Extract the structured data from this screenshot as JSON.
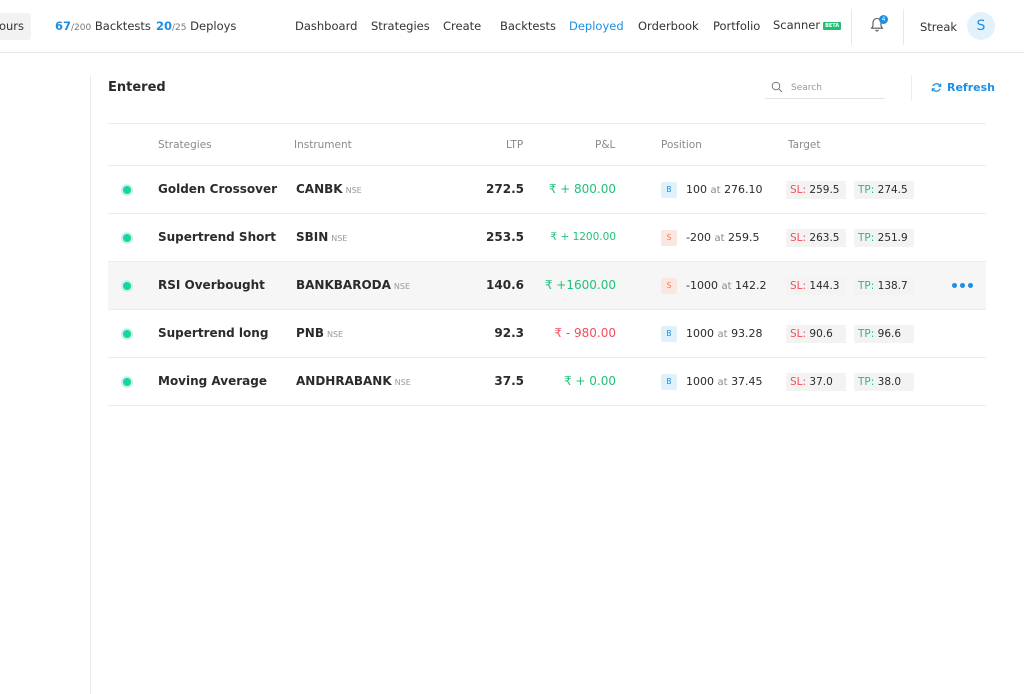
{
  "header": {
    "hours_label": "ours",
    "backtests": {
      "used": "67",
      "total": "/200",
      "label": "Backtests"
    },
    "deploys": {
      "used": "20",
      "total": "/25",
      "label": "Deploys"
    },
    "nav": [
      {
        "label": "Dashboard"
      },
      {
        "label": "Strategies"
      },
      {
        "label": "Create"
      },
      {
        "label": "Backtests"
      },
      {
        "label": "Deployed"
      },
      {
        "label": "Orderbook"
      },
      {
        "label": "Portfolio"
      },
      {
        "label": "Scanner",
        "badge": "BETA"
      }
    ],
    "active_nav": "Deployed",
    "notification_count": "4",
    "streak_label": "Streak",
    "avatar_initial": "S"
  },
  "panel": {
    "title": "Entered",
    "search_placeholder": "Search",
    "refresh_label": "Refresh"
  },
  "table": {
    "columns": [
      "Strategies",
      "Instrument",
      "LTP",
      "P&L",
      "Position",
      "Target"
    ],
    "rows": [
      {
        "strategy": "Golden Crossover",
        "instrument": "CANBK",
        "exchange": "NSE",
        "ltp": "272.5",
        "pnl": "₹ + 800.00",
        "pnl_sign": "pos",
        "side": "B",
        "qty": "100",
        "at": "at",
        "price": "276.10",
        "sl_label": "SL:",
        "sl": "259.5",
        "tp_label": "TP:",
        "tp": "274.5"
      },
      {
        "strategy": "Supertrend Short",
        "instrument": "SBIN",
        "exchange": "NSE",
        "ltp": "253.5",
        "pnl": "₹ + 1200.00",
        "pnl_sign": "pos",
        "side": "S",
        "qty": "-200",
        "at": "at",
        "price": "259.5",
        "sl_label": "SL:",
        "sl": "263.5",
        "tp_label": "TP:",
        "tp": "251.9"
      },
      {
        "strategy": "RSI Overbought",
        "instrument": "BANKBARODA",
        "exchange": "NSE",
        "ltp": "140.6",
        "pnl": "₹ +1600.00",
        "pnl_sign": "pos",
        "side": "S",
        "qty": "-1000",
        "at": "at",
        "price": "142.2",
        "sl_label": "SL:",
        "sl": "144.3",
        "tp_label": "TP:",
        "tp": "138.7"
      },
      {
        "strategy": "Supertrend long",
        "instrument": "PNB",
        "exchange": "NSE",
        "ltp": "92.3",
        "pnl": "₹ - 980.00",
        "pnl_sign": "neg",
        "side": "B",
        "qty": "1000",
        "at": "at",
        "price": "93.28",
        "sl_label": "SL:",
        "sl": "90.6",
        "tp_label": "TP:",
        "tp": "96.6"
      },
      {
        "strategy": "Moving Average",
        "instrument": "ANDHRABANK",
        "exchange": "NSE",
        "ltp": "37.5",
        "pnl": "₹ + 0.00",
        "pnl_sign": "pos",
        "side": "B",
        "qty": "1000",
        "at": "at",
        "price": "37.45",
        "sl_label": "SL:",
        "sl": "37.0",
        "tp_label": "TP:",
        "tp": "38.0"
      }
    ]
  },
  "colors": {
    "accent": "#1b8fe6",
    "profit": "#1fc27a",
    "loss": "#f04e5e",
    "status_active": "#19d3a2"
  }
}
